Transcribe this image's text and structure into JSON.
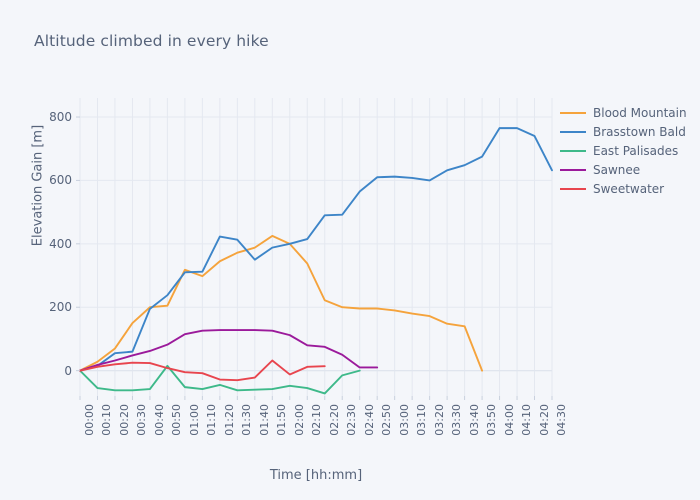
{
  "chart_data": {
    "type": "line",
    "title": "Altitude climbed in every hike",
    "xlabel": "Time [hh:mm]",
    "ylabel": "Elevation Gain [m]",
    "ylim": [
      -80,
      860
    ],
    "yticks": [
      0,
      200,
      400,
      600,
      800
    ],
    "grid": true,
    "legend_position": "right",
    "background_color": "#f4f6fa",
    "plot_background_color": "#f4f6fa",
    "grid_color": "#e4e8f0",
    "x": [
      "00:00",
      "00:10",
      "00:20",
      "00:30",
      "00:40",
      "00:50",
      "01:00",
      "01:10",
      "01:20",
      "01:30",
      "01:40",
      "01:50",
      "02:00",
      "02:10",
      "02:20",
      "02:30",
      "02:40",
      "02:50",
      "03:00",
      "03:10",
      "03:20",
      "03:30",
      "03:40",
      "03:50",
      "04:00",
      "04:10",
      "04:20",
      "04:30"
    ],
    "series": [
      {
        "name": "Blood Mountain",
        "color": "#f5a33c",
        "values": [
          0,
          28,
          70,
          150,
          200,
          205,
          318,
          298,
          345,
          372,
          388,
          425,
          400,
          338,
          222,
          200,
          196,
          196,
          190,
          180,
          172,
          148,
          140,
          0
        ]
      },
      {
        "name": "Brasstown Bald",
        "color": "#3d85c8",
        "values": [
          0,
          15,
          55,
          60,
          195,
          238,
          310,
          312,
          423,
          413,
          350,
          388,
          400,
          415,
          490,
          492,
          565,
          610,
          612,
          608,
          600,
          632,
          648,
          675,
          765,
          765,
          740,
          632
        ]
      },
      {
        "name": "East Palisades",
        "color": "#3eb98a",
        "values": [
          0,
          -55,
          -62,
          -62,
          -58,
          15,
          -52,
          -58,
          -45,
          -62,
          -60,
          -58,
          -48,
          -55,
          -72,
          -15,
          0
        ]
      },
      {
        "name": "Sawnee",
        "color": "#9b1a9b",
        "values": [
          0,
          18,
          32,
          48,
          62,
          82,
          115,
          126,
          128,
          128,
          128,
          126,
          112,
          80,
          75,
          50,
          10,
          10
        ]
      },
      {
        "name": "Sweetwater",
        "color": "#e8454e",
        "values": [
          0,
          12,
          20,
          25,
          24,
          8,
          -5,
          -8,
          -28,
          -30,
          -22,
          32,
          -12,
          12,
          14
        ]
      }
    ]
  },
  "legend": {
    "items": [
      {
        "label": "Blood Mountain",
        "color": "#f5a33c"
      },
      {
        "label": "Brasstown Bald",
        "color": "#3d85c8"
      },
      {
        "label": "East Palisades",
        "color": "#3eb98a"
      },
      {
        "label": "Sawnee",
        "color": "#9b1a9b"
      },
      {
        "label": "Sweetwater",
        "color": "#e8454e"
      }
    ]
  }
}
